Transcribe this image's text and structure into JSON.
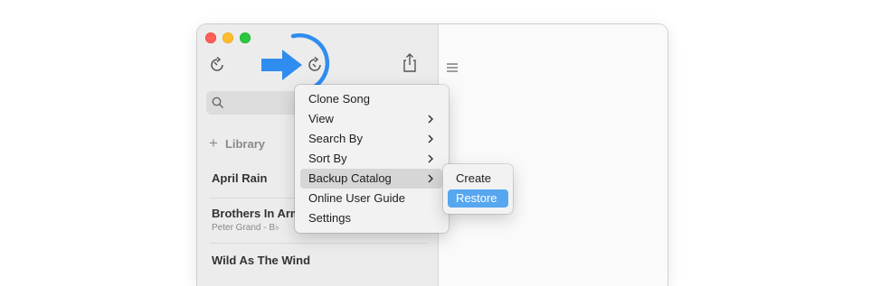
{
  "sidebar": {
    "library_label": "Library",
    "songs": [
      {
        "title": "April Rain"
      },
      {
        "title": "Brothers In Arms",
        "subtitle": "Peter Grand - B♭"
      },
      {
        "title": "Wild As The Wind"
      }
    ]
  },
  "context_menu": {
    "items": [
      {
        "label": "Clone Song",
        "submenu": false
      },
      {
        "label": "View",
        "submenu": true
      },
      {
        "label": "Search By",
        "submenu": true
      },
      {
        "label": "Sort By",
        "submenu": true
      },
      {
        "label": "Backup Catalog",
        "submenu": true,
        "highlighted": true
      },
      {
        "label": "Online User Guide",
        "submenu": false
      },
      {
        "label": "Settings",
        "submenu": false
      }
    ]
  },
  "backup_submenu": {
    "items": [
      {
        "label": "Create"
      },
      {
        "label": "Restore",
        "selected": true
      }
    ]
  },
  "icons": {
    "toolbar": [
      "sync-icon",
      "sync-menu-icon",
      "share-icon",
      "list-icon"
    ],
    "annotation": [
      "blue-arrow-icon",
      "blue-circle-highlight"
    ]
  },
  "colors": {
    "accent": "#57a6f0",
    "annotation_blue": "#2f8df0",
    "traffic_red": "#ff5f57",
    "traffic_yellow": "#febc2e",
    "traffic_green": "#28c840"
  }
}
